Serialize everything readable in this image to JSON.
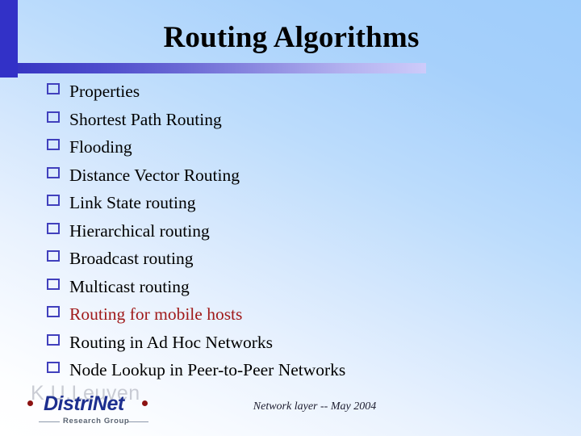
{
  "slide": {
    "title": "Routing Algorithms",
    "accent_color": "#3231c7",
    "rule_gradient_from": "#3736c3",
    "rule_gradient_to": "#cdcbfa",
    "background_top_right": "#9fcdfb",
    "background_bottom_left": "#ffffff",
    "bullets": [
      {
        "label": "Properties",
        "color": "#000000",
        "highlighted": false
      },
      {
        "label": "Shortest Path Routing",
        "color": "#000000",
        "highlighted": false
      },
      {
        "label": "Flooding",
        "color": "#000000",
        "highlighted": false
      },
      {
        "label": "Distance Vector Routing",
        "color": "#000000",
        "highlighted": false
      },
      {
        "label": "Link State routing",
        "color": "#000000",
        "highlighted": false
      },
      {
        "label": "Hierarchical routing",
        "color": "#000000",
        "highlighted": false
      },
      {
        "label": "Broadcast routing",
        "color": "#000000",
        "highlighted": false
      },
      {
        "label": "Multicast routing",
        "color": "#000000",
        "highlighted": false
      },
      {
        "label": "Routing for mobile hosts",
        "color": "#a01a1a",
        "highlighted": true
      },
      {
        "label": "Routing in Ad Hoc Networks",
        "color": "#000000",
        "highlighted": false
      },
      {
        "label": "Node Lookup in Peer-to-Peer Networks",
        "color": "#000000",
        "highlighted": false
      }
    ],
    "bullet_glyph": "hollow-square-bullet-icon",
    "footer": "Network layer -- May 2004",
    "logo": {
      "university": "K.U.Leuven",
      "name": "DistriNet",
      "subtitle": "Research Group",
      "name_color": "#1d2f8f",
      "dot_color": "#8c1212"
    }
  }
}
